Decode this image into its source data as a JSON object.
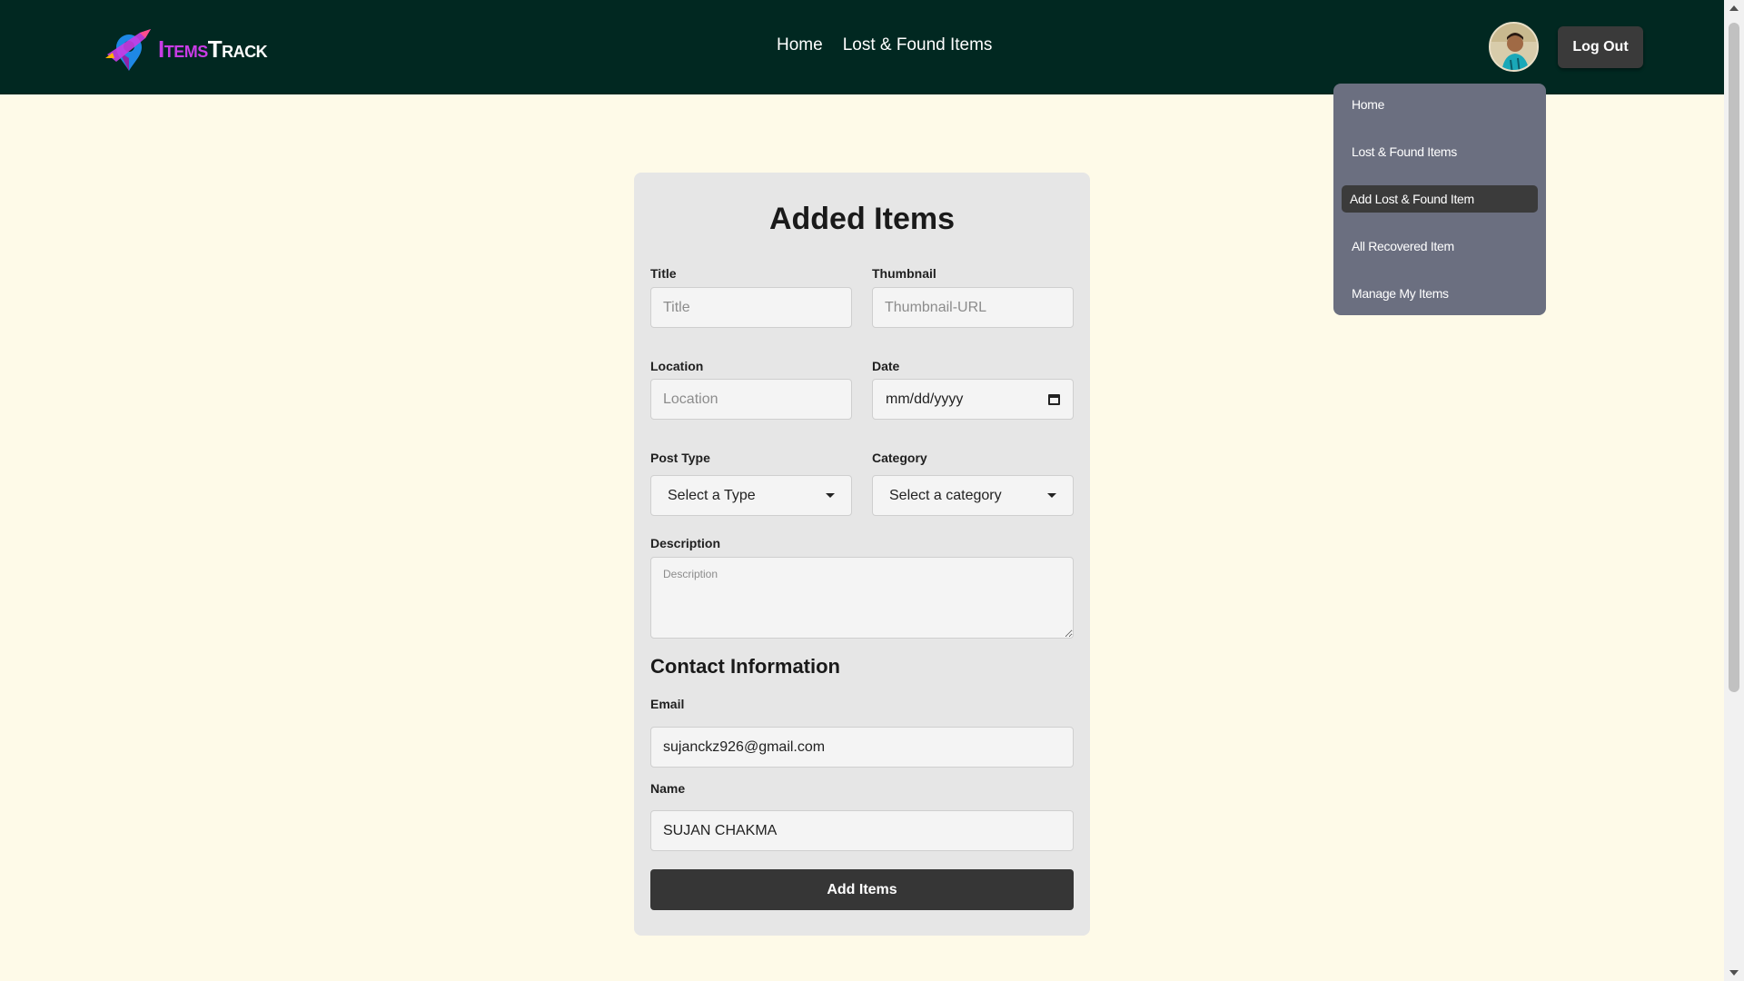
{
  "navbar": {
    "brand_part1": "Items",
    "brand_part2": "Track",
    "links": [
      "Home",
      "Lost & Found Items"
    ],
    "logout_label": "Log Out"
  },
  "dropdown": {
    "items": [
      "Home",
      "Lost & Found Items",
      "Add Lost & Found Item",
      "All Recovered Item",
      "Manage My Items"
    ],
    "active_item": "Add Lost & Found Item"
  },
  "form": {
    "heading": "Added Items",
    "title_label": "Title",
    "title_placeholder": "Title",
    "thumbnail_label": "Thumbnail",
    "thumbnail_placeholder": "Thumbnail-URL",
    "location_label": "Location",
    "location_placeholder": "Location",
    "date_label": "Date",
    "date_placeholder": "mm/dd/yyyy",
    "post_type_label": "Post Type",
    "post_type_value": "Select a Type",
    "category_label": "Category",
    "category_value": "Select a category",
    "description_label": "Description",
    "description_placeholder": "Description",
    "contact_heading": "Contact Information",
    "email_label": "Email",
    "email_value": "sujanckz926@gmail.com",
    "name_label": "Name",
    "name_value": "SUJAN CHAKMA",
    "submit_label": "Add Items"
  },
  "colors": {
    "navbar_bg": "#012821",
    "page_bg": "#fefae8",
    "brand_accent": "#c93ce6",
    "dropdown_bg": "#6b6f80",
    "button_dark": "#363636"
  }
}
